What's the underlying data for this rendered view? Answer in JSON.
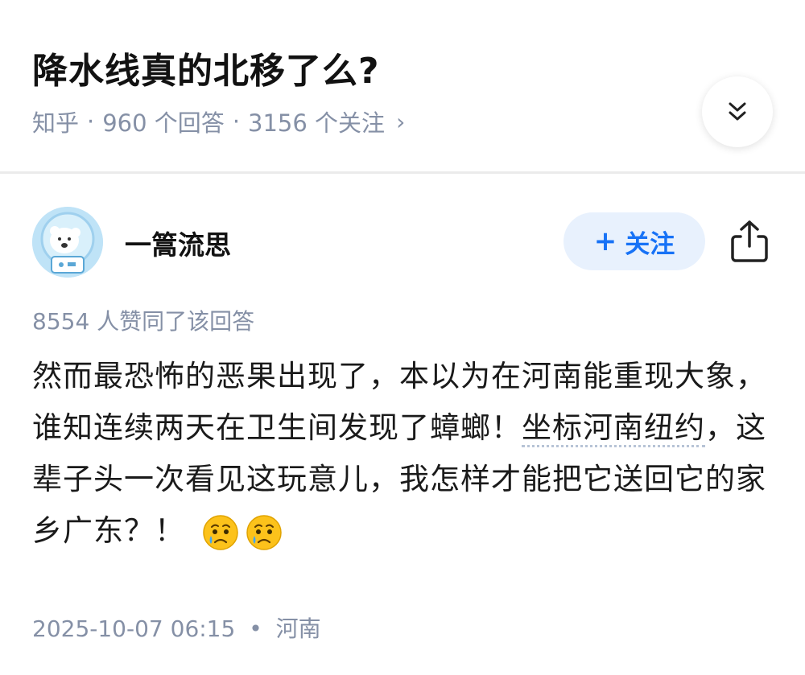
{
  "question": {
    "title": "降水线真的北移了么?",
    "source": "知乎",
    "answers": "960 个回答",
    "followers": "3156 个关注",
    "separator": "·",
    "chevron": "›"
  },
  "answer": {
    "author": {
      "name": "一篙流思",
      "avatar_icon": "polar-bear-avatar-icon"
    },
    "follow_button": {
      "plus": "+",
      "label": "关注"
    },
    "share_icon": "share-icon",
    "votes": "8554 人赞同了该回答",
    "content": {
      "part1": "然而最恐怖的恶果出现了，本以为在河南能重现大象，谁知连续两天在卫生间发现了蟑螂！",
      "link": "坐标河南纽约",
      "part2": "，这辈子头一次看见这玩意儿，我怎样才能把它送回它的家乡广东？！"
    },
    "emojis": [
      "crying-face-icon",
      "crying-face-icon"
    ],
    "footer": {
      "time": "2025-10-07 06:15",
      "dot": "•",
      "location": "河南"
    }
  },
  "colors": {
    "accent": "#1772f6",
    "follow_bg": "#e8f1fd",
    "meta_gray": "#8590a6",
    "avatar_bg": "#bfe3f7"
  }
}
